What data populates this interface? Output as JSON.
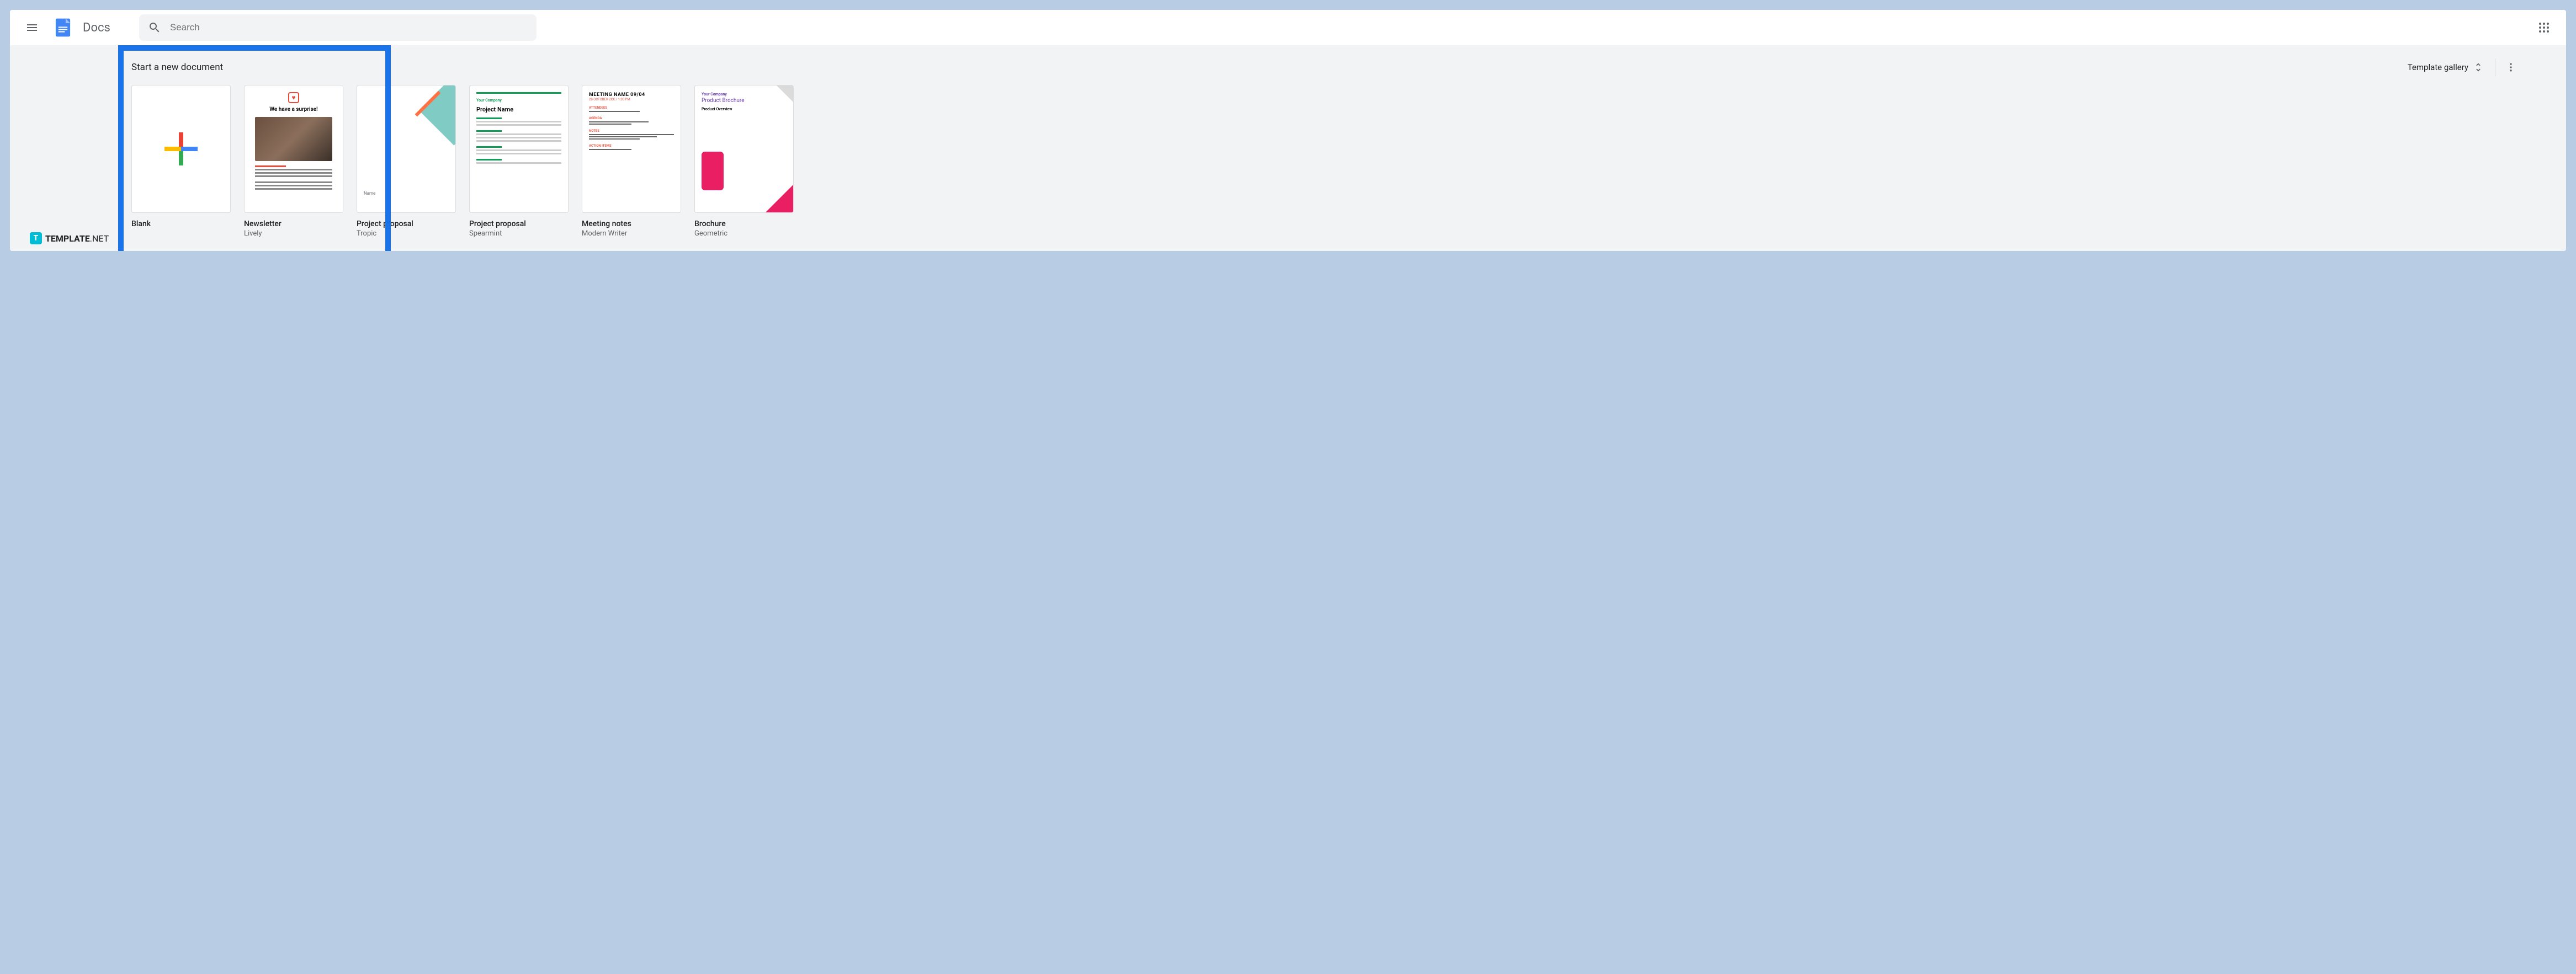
{
  "header": {
    "app_name": "Docs",
    "search_placeholder": "Search"
  },
  "section": {
    "title": "Start a new document",
    "gallery_label": "Template gallery"
  },
  "templates": [
    {
      "title": "Blank",
      "subtitle": ""
    },
    {
      "title": "Newsletter",
      "subtitle": "Lively"
    },
    {
      "title": "Project proposal",
      "subtitle": "Tropic",
      "truncated_title": "Proj"
    },
    {
      "title": "Project proposal",
      "subtitle": "Spearmint"
    },
    {
      "title": "Meeting notes",
      "subtitle": "Modern Writer"
    },
    {
      "title": "Brochure",
      "subtitle": "Geometric"
    }
  ],
  "thumb_text": {
    "newsletter_heading": "We have a surprise!",
    "pp1_label": "Name",
    "pp2_company": "Your Company",
    "pp2_title": "Project Name",
    "mn_title": "MEETING NAME 09/04",
    "br_company": "Your Company",
    "br_title": "Product Brochure",
    "br_sub": "Product Overview"
  },
  "watermark": {
    "badge": "T",
    "name": "TEMPLATE",
    "suffix": ".NET"
  }
}
